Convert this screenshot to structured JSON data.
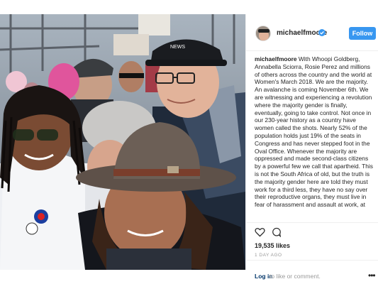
{
  "post": {
    "username": "michaelfmoore",
    "follow_label": "Follow",
    "caption_username": "michaelfmoore",
    "caption_text": "With Whoopi Goldberg, Annabella Sciorra, Rosie Perez and millions of others across the country and the world at Women's March 2018. We are the majority. An avalanche is coming November 6th. We are witnessing and experiencing a revolution where the majority gender is finally, eventually, going to take control. Not once in our 230-year history as a country have women called the shots. Nearly 52% of the population holds just 19% of the seats in Congress and has never stepped foot in the Oval Office. Whenever the majority are oppressed and made second-class citizens by a powerful few we call that apartheid. This is not the South Africa of old, but the truth is the majority gender here are told they must work for a third less, they have no say over their reproductive organs, they must live in fear of harassment and assault at work, at",
    "likes": "19,535 likes",
    "timestamp": "1 DAY AGO",
    "login_link": "Log in",
    "login_rest": " to like or comment.",
    "more_label": "•••"
  },
  "photo": {
    "cap_text": "NEWS"
  },
  "icons": {
    "verified": "verified-badge-icon",
    "like": "heart-icon",
    "comment": "comment-bubble-icon",
    "more": "more-options-icon"
  },
  "colors": {
    "follow_button": "#3897f0",
    "link": "#003569",
    "muted": "#999999",
    "divider": "#efefef"
  }
}
